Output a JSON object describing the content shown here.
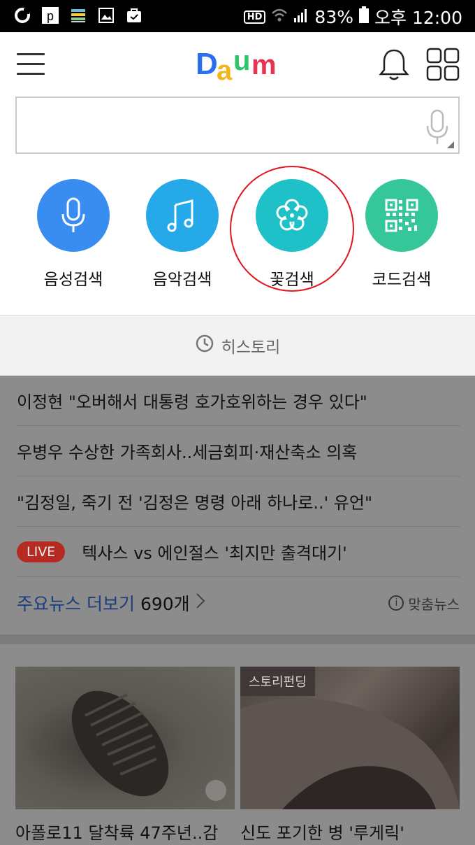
{
  "status_bar": {
    "battery": "83%",
    "time": "오후 12:00",
    "hd": "HD",
    "left_icons": [
      "o-icon",
      "p-icon",
      "flag-icon",
      "image-icon",
      "bag-icon"
    ]
  },
  "header": {
    "logo_text": "Daum",
    "logo_colors": [
      "#2b6ff0",
      "#f3b51b",
      "#2ec46a",
      "#e8344e"
    ]
  },
  "search": {
    "value": "",
    "placeholder": ""
  },
  "quick_search": [
    {
      "label": "음성검색",
      "icon": "mic-icon",
      "color": "#3a8df0"
    },
    {
      "label": "음악검색",
      "icon": "music-note-icon",
      "color": "#26a9e8"
    },
    {
      "label": "꽃검색",
      "icon": "flower-icon",
      "color": "#1fc1c8"
    },
    {
      "label": "코드검색",
      "icon": "qr-code-icon",
      "color": "#35c79a"
    }
  ],
  "history": {
    "label": "히스토리"
  },
  "news": {
    "items": [
      "이정현 \"오버해서 대통령 호가호위하는 경우 있다\"",
      "우병우 수상한 가족회사..세금회피·재산축소 의혹",
      "\"김정일, 죽기 전 '김정은 명령 아래 하나로..' 유언\""
    ],
    "live": {
      "badge": "LIVE",
      "text": "텍사스 vs 에인절스 '최지만 출격대기'"
    },
    "more_label": "주요뉴스 더보기",
    "more_count": "690개",
    "custom_label": "맞춤뉴스"
  },
  "cards": [
    {
      "title": "아폴로11 달착륙 47주년..감",
      "badge": ""
    },
    {
      "title": "신도 포기한 병 '루게릭'",
      "badge": "스토리펀딩"
    }
  ]
}
